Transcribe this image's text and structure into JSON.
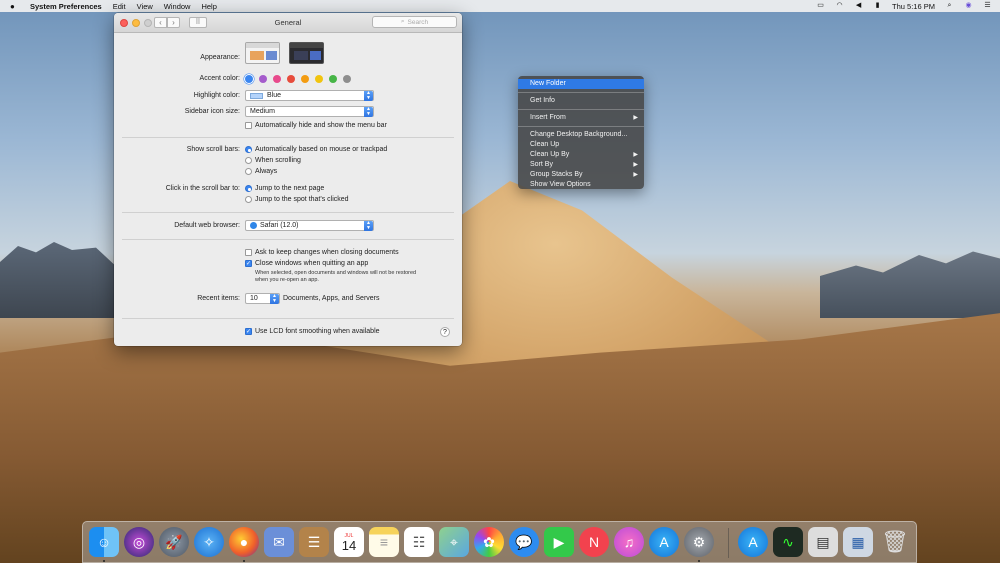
{
  "menubar": {
    "apple": "",
    "app_name": "System Preferences",
    "items": [
      "Edit",
      "View",
      "Window",
      "Help"
    ],
    "clock": "Thu 5:16 PM"
  },
  "window": {
    "title": "General",
    "search_placeholder": "Search",
    "appearance_label": "Appearance:",
    "accent_label": "Accent color:",
    "accent_colors": [
      "#3b86f0",
      "#a55ccc",
      "#e84a8c",
      "#e74c3c",
      "#f39c12",
      "#f1c40f",
      "#47b547",
      "#8e8e8e"
    ],
    "highlight_label": "Highlight color:",
    "highlight_value": "Blue",
    "sidebar_label": "Sidebar icon size:",
    "sidebar_value": "Medium",
    "autohide_menu": "Automatically hide and show the menu bar",
    "scroll_bars_label": "Show scroll bars:",
    "scroll_opt1": "Automatically based on mouse or trackpad",
    "scroll_opt2": "When scrolling",
    "scroll_opt3": "Always",
    "click_label": "Click in the scroll bar to:",
    "click_opt1": "Jump to the next page",
    "click_opt2": "Jump to the spot that's clicked",
    "browser_label": "Default web browser:",
    "browser_value": "Safari (12.0)",
    "ask_keep": "Ask to keep changes when closing documents",
    "close_windows": "Close windows when quitting an app",
    "close_note_1": "When selected, open documents and windows will not be restored",
    "close_note_2": "when you re-open an app.",
    "recent_label": "Recent items:",
    "recent_value": "10",
    "recent_suffix": "Documents, Apps, and Servers",
    "lcd": "Use LCD font smoothing when available",
    "help": "?"
  },
  "context_menu": {
    "items": [
      "New Folder",
      "Get Info",
      "Insert From",
      "Change Desktop Background...",
      "Clean Up",
      "Clean Up By",
      "Sort By",
      "Group Stacks By",
      "Show View Options"
    ]
  },
  "dock": {
    "icons": [
      "finder-icon",
      "siri-icon",
      "launchpad-icon",
      "safari-icon",
      "firefox-icon",
      "mail-icon",
      "contacts-icon",
      "calendar-icon",
      "notes-icon",
      "reminders-icon",
      "maps-icon",
      "photos-icon",
      "messages-icon",
      "facetime-icon",
      "news-icon",
      "itunes-icon",
      "app-store-icon",
      "system-preferences-icon",
      "app-store-download-icon",
      "activity-monitor-icon",
      "preview-icon",
      "network-icon",
      "trash-icon"
    ],
    "calendar_month": "JUL",
    "calendar_day": "14"
  }
}
